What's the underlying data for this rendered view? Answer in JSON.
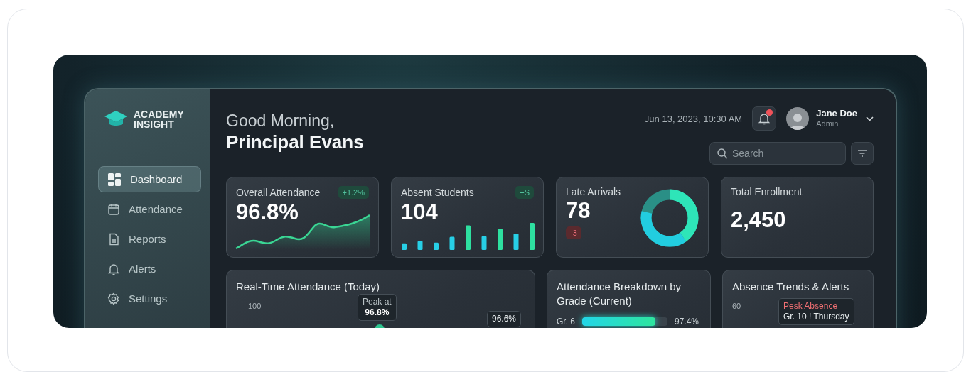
{
  "brand": {
    "line1": "ACADEMY",
    "line2": "INSIGHT"
  },
  "nav": [
    {
      "label": "Dashboard",
      "selected": true
    },
    {
      "label": "Attendance",
      "selected": false
    },
    {
      "label": "Reports",
      "selected": false
    },
    {
      "label": "Alerts",
      "selected": false
    },
    {
      "label": "Settings",
      "selected": false
    }
  ],
  "greeting": "Good Morning,",
  "name": "Principal Evans",
  "datetime": "Jun 13, 2023, 10:30 AM",
  "notifications": {
    "unread": true
  },
  "user": {
    "name": "Jane Doe",
    "role": "Admin"
  },
  "search": {
    "placeholder": "Search"
  },
  "stats": [
    {
      "kind": "sparkline",
      "title": "Overall Attendance",
      "value": "96.8%",
      "badge": {
        "text": "+1.2%",
        "color": "#1f4a3c"
      }
    },
    {
      "kind": "bars",
      "title": "Absent Students",
      "value": "104",
      "badge": {
        "text": "+S",
        "color": "#1f4a3c"
      }
    },
    {
      "kind": "donut",
      "title": "Late Arrivals",
      "value": "78",
      "badge": {
        "text": "-3",
        "color": "#5a2a2e"
      }
    },
    {
      "kind": "plain",
      "title": "Total Enrollment",
      "value": "2,450"
    }
  ],
  "realtime": {
    "title": "Real-Time Attendance (Today)",
    "axis_label": "100",
    "tooltip": {
      "label": "Peak at",
      "value": "96.8%"
    },
    "current": "96.6%"
  },
  "breakdown": {
    "title": "Attendance Breakdown by Grade (Current)",
    "grades": [
      {
        "label": "Gr. 6",
        "level": 0.86,
        "reading": "97.4%"
      }
    ]
  },
  "trends": {
    "title": "Absence Trends & Alerts",
    "axis_label": "60",
    "tooltip": {
      "title": "Pesk Absence",
      "detail": "Gr. 10 ! Thursday"
    }
  }
}
